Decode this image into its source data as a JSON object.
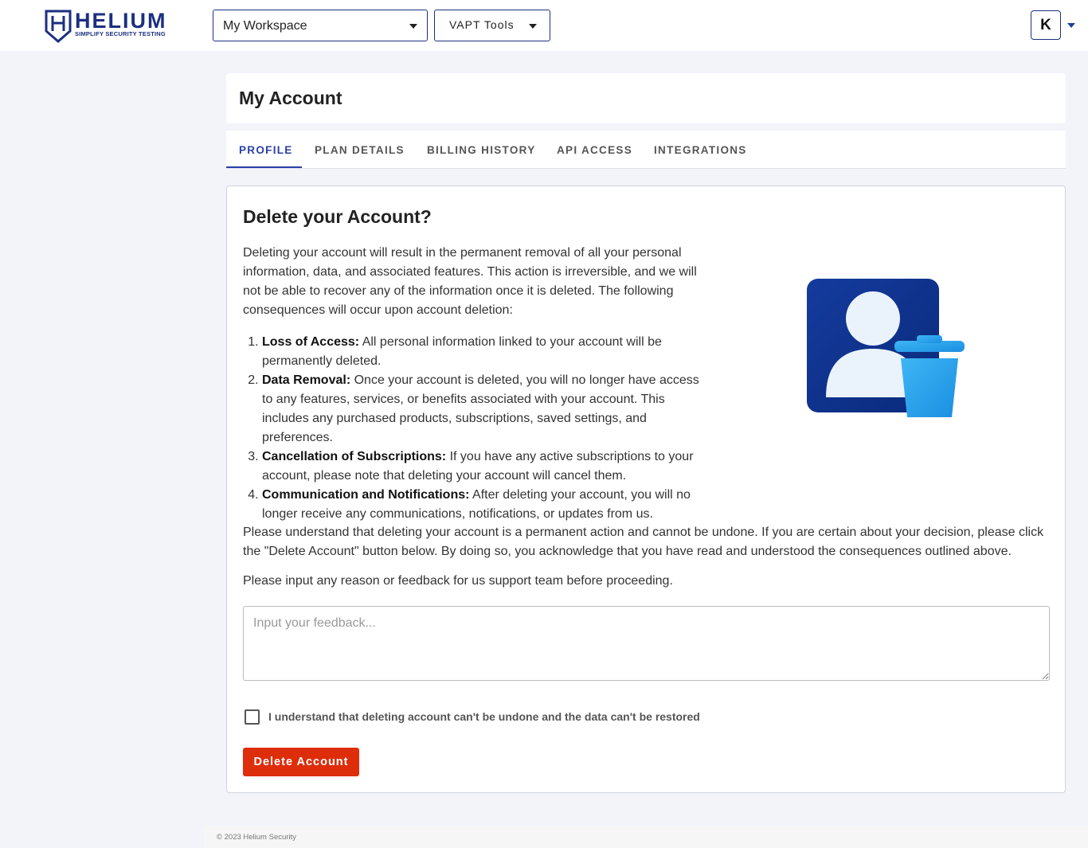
{
  "topbar": {
    "logo": {
      "brand": "HELIUM",
      "tagline": "SIMPLIFY SECURITY TESTING"
    },
    "workspace_select": {
      "value": "My Workspace"
    },
    "tools_select": {
      "value": "VAPT Tools"
    },
    "avatar": {
      "initial": "K"
    }
  },
  "header": {
    "title": "My Account"
  },
  "tabs": [
    {
      "label": "PROFILE",
      "active": true
    },
    {
      "label": "PLAN DETAILS",
      "active": false
    },
    {
      "label": "BILLING HISTORY",
      "active": false
    },
    {
      "label": "API ACCESS",
      "active": false
    },
    {
      "label": "INTEGRATIONS",
      "active": false
    }
  ],
  "delete_section": {
    "title": "Delete your Account?",
    "intro": "Deleting your account will result in the permanent removal of all your personal information, data, and associated features. This action is irreversible, and we will not be able to recover any of the information once it is deleted. The following consequences will occur upon account deletion:",
    "consequences": [
      {
        "title": "Loss of Access:",
        "text": " All personal information linked to your account will be permanently deleted."
      },
      {
        "title": "Data Removal:",
        "text": " Once your account is deleted, you will no longer have access to any features, services, or benefits associated with your account. This includes any purchased products, subscriptions, saved settings, and preferences."
      },
      {
        "title": "Cancellation of Subscriptions:",
        "text": " If you have any active subscriptions to your account, please note that deleting your account will cancel them."
      },
      {
        "title": "Communication and Notifications:",
        "text": " After deleting your account, you will no longer receive any communications, notifications, or updates from us."
      }
    ],
    "permanent_notice": "Please understand that deleting your account is a permanent action and cannot be undone. If you are certain about your decision, please click the \"Delete Account\" button below. By doing so, you acknowledge that you have read and understood the consequences outlined above.",
    "feedback_prompt": "Please input any reason or feedback for us support team before proceeding.",
    "feedback_placeholder": "Input your feedback...",
    "feedback_value": "",
    "confirm_label": "I understand that deleting account can't be undone and the data can't be restored",
    "confirm_checked": false,
    "delete_button": "Delete Account"
  },
  "colors": {
    "brand": "#1c2f80",
    "accent": "#2a3fa6",
    "danger": "#dd2d0b",
    "background": "#f2f4fa"
  },
  "footer": {
    "copyright": "© 2023 Helium Security"
  }
}
